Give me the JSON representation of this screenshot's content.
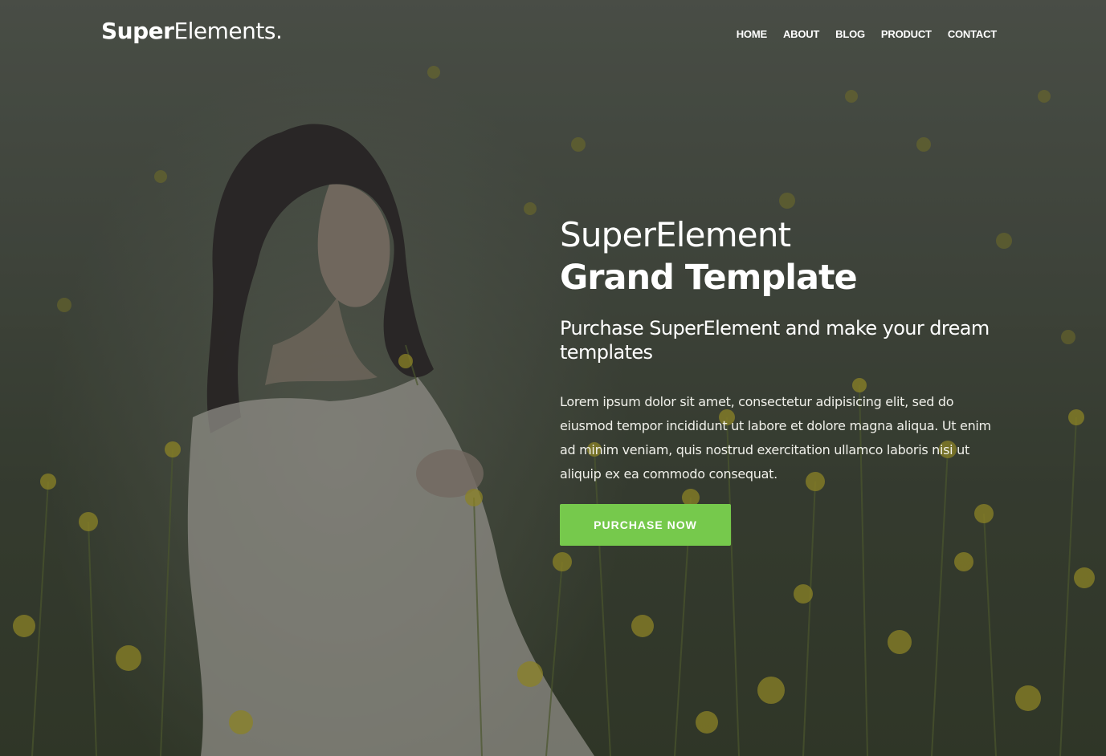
{
  "nav": {
    "logo_bold": "Super",
    "logo_light": "Elements.",
    "items": [
      "HOME",
      "ABOUT",
      "BLOG",
      "PRODUCT",
      "CONTACT"
    ]
  },
  "hero": {
    "title_light": "SuperElement",
    "title_bold": "Grand Template",
    "subtitle": "Purchase SuperElement and make your dream templates",
    "body": "Lorem ipsum dolor sit amet, consectetur adipisicing elit, sed do eiusmod tempor incididunt ut labore et dolore magna aliqua. Ut enim ad minim veniam, quis nostrud exercitation ullamco laboris nisi ut aliquip ex ea commodo consequat.",
    "cta_label": "PURCHASE NOW"
  },
  "colors": {
    "accent": "#76c94c",
    "background": "#3f4638",
    "text": "#ffffff"
  }
}
